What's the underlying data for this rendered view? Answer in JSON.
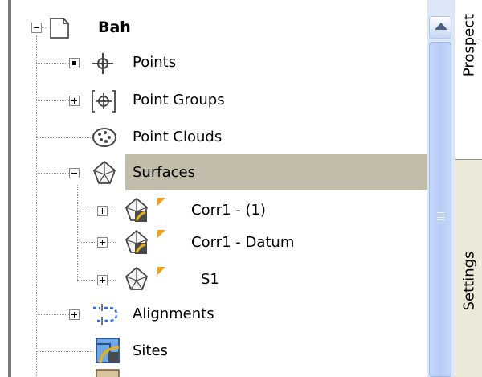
{
  "tree": {
    "root": {
      "label": "Bah",
      "expander": "collapse"
    },
    "items": [
      {
        "label": "Points",
        "icon": "points-icon"
      },
      {
        "label": "Point Groups",
        "icon": "point-groups-icon",
        "expander": "expand"
      },
      {
        "label": "Point Clouds",
        "icon": "point-clouds-icon"
      },
      {
        "label": "Surfaces",
        "icon": "surface-icon",
        "expander": "collapse",
        "selected": true,
        "children": [
          {
            "label": "Corr1 - (1)",
            "icon": "surface-corridor-icon",
            "expander": "expand"
          },
          {
            "label": "Corr1 - Datum",
            "icon": "surface-corridor-icon",
            "expander": "expand"
          },
          {
            "label": "S1",
            "icon": "surface-icon",
            "expander": "expand"
          }
        ]
      },
      {
        "label": "Alignments",
        "icon": "alignment-icon",
        "expander": "expand"
      },
      {
        "label": "Sites",
        "icon": "sites-icon"
      }
    ]
  },
  "tabs": [
    {
      "label": "Prospect",
      "active": true
    },
    {
      "label": "Settings",
      "active": false
    }
  ],
  "colors": {
    "selection": "#c2bcab",
    "scrollbar": "#dbe6f7",
    "tab_strip": "#ece9d8"
  }
}
